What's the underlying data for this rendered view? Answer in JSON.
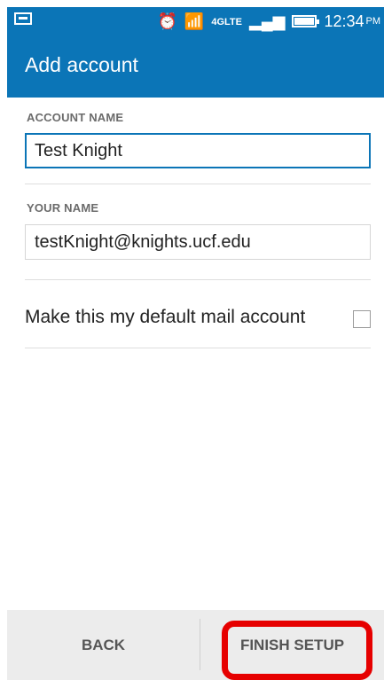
{
  "status_bar": {
    "icons": [
      "screen-icon",
      "alarm-icon",
      "wifi-icon",
      "lte-icon",
      "signal-icon",
      "battery-icon"
    ],
    "network_label": "4G",
    "lte_label": "LTE",
    "time": "12:34",
    "ampm": "PM"
  },
  "app_bar": {
    "title": "Add account",
    "accent": "#0b75b7"
  },
  "form": {
    "account_name_label": "ACCOUNT NAME",
    "account_name_value": "Test Knight",
    "your_name_label": "YOUR NAME",
    "your_name_value": "testKnight@knights.ucf.edu",
    "default_account_label": "Make this my default mail account",
    "default_account_checked": false
  },
  "buttons": {
    "back": "BACK",
    "finish_setup": "FINISH SETUP"
  },
  "annotation": {
    "highlight_color": "#e60000"
  }
}
